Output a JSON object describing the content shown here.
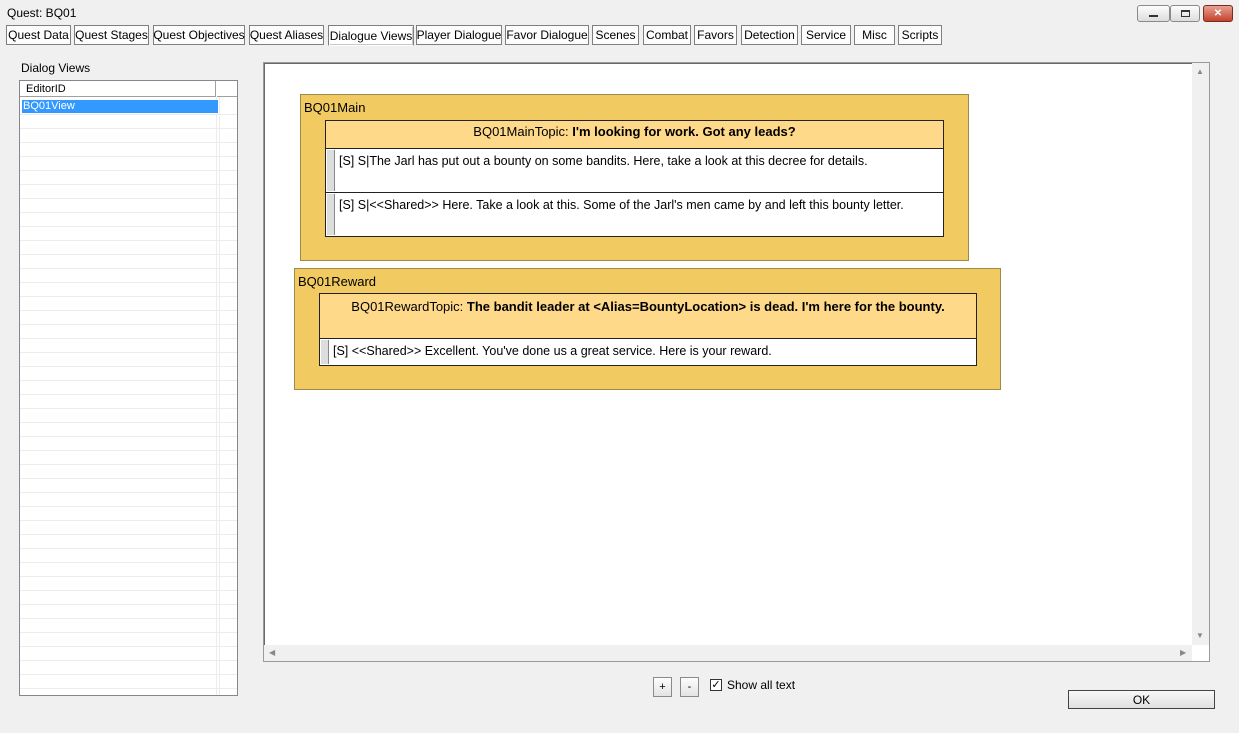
{
  "window": {
    "title": "Quest: BQ01"
  },
  "tabs": [
    {
      "label": "Quest Data"
    },
    {
      "label": "Quest Stages"
    },
    {
      "label": "Quest Objectives"
    },
    {
      "label": "Quest Aliases"
    },
    {
      "label": "Dialogue Views",
      "active": true
    },
    {
      "label": "Player Dialogue"
    },
    {
      "label": "Favor Dialogue"
    },
    {
      "label": "Scenes"
    },
    {
      "label": "Combat"
    },
    {
      "label": "Favors"
    },
    {
      "label": "Detection"
    },
    {
      "label": "Service"
    },
    {
      "label": "Misc"
    },
    {
      "label": "Scripts"
    }
  ],
  "dialog_views": {
    "label": "Dialog Views",
    "column_header": "EditorID",
    "items": [
      {
        "editor_id": "BQ01View",
        "selected": true
      }
    ]
  },
  "canvas": {
    "branches": [
      {
        "name": "BQ01Main",
        "topic_id": "BQ01MainTopic:",
        "topic_text": "I'm looking for work. Got any leads?",
        "responses": [
          "[S] S|The Jarl has put out a bounty on some bandits. Here, take a look at this decree for details.",
          "[S] S|<<Shared>> Here. Take a look at this. Some of the Jarl's men came by and left this bounty letter."
        ]
      },
      {
        "name": "BQ01Reward",
        "topic_id": "BQ01RewardTopic:",
        "topic_text": "The bandit leader at <Alias=BountyLocation> is dead. I'm here for the bounty.",
        "responses": [
          "[S] <<Shared>> Excellent. You've done us a great service. Here is your reward."
        ]
      }
    ]
  },
  "controls": {
    "zoom_in_label": "+",
    "zoom_out_label": "-",
    "show_all_text_label": "Show all text",
    "show_all_text_checked": true,
    "checkmark": "✓",
    "ok_label": "OK"
  }
}
